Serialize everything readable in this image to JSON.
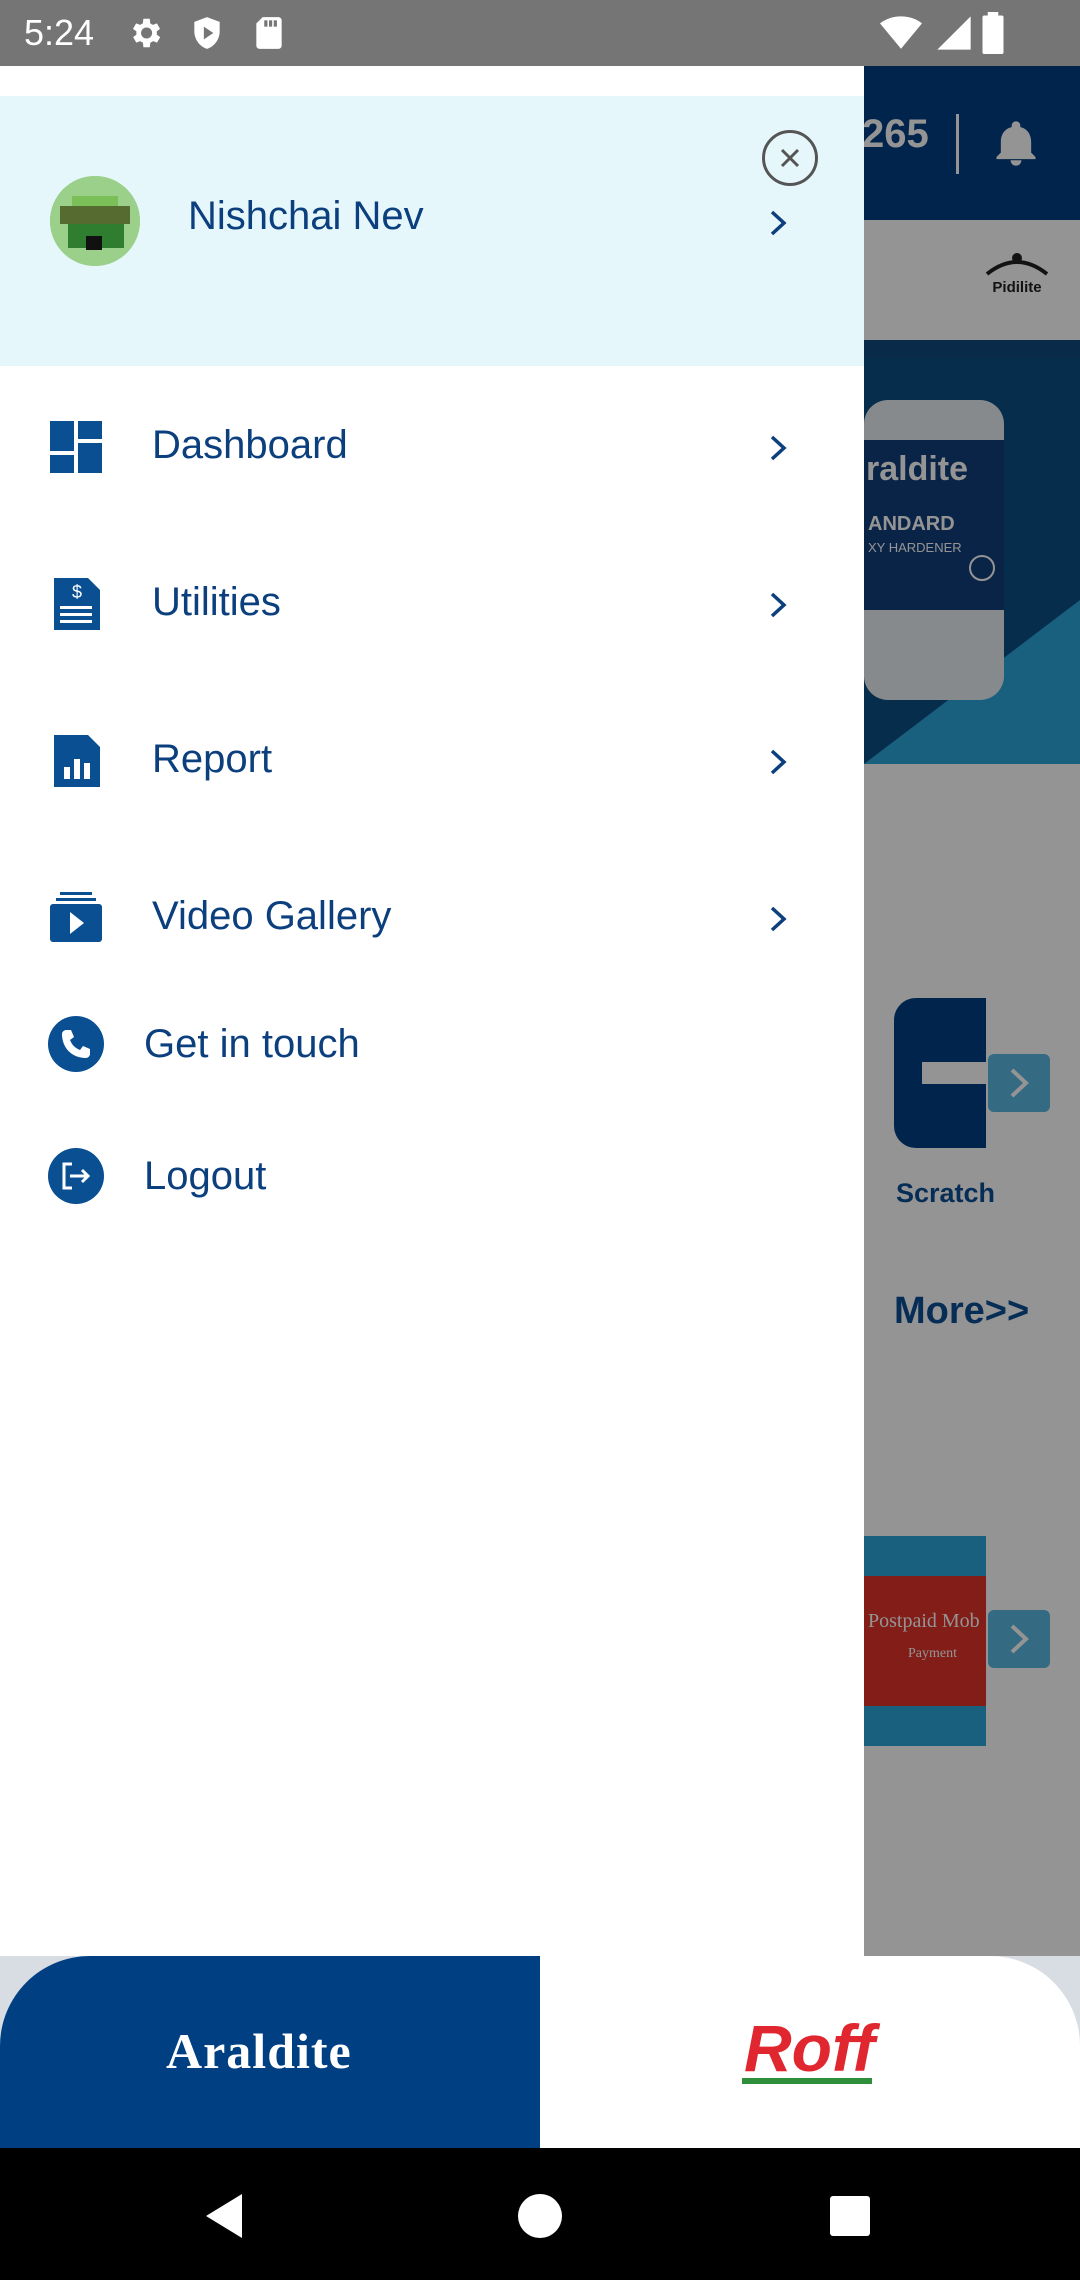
{
  "status_bar": {
    "time": "5:24",
    "left_icons": [
      "settings-icon",
      "shield-icon",
      "sd-card-icon"
    ],
    "right_icons": [
      "wifi-icon",
      "signal-icon",
      "battery-icon"
    ]
  },
  "background_app": {
    "points": "265",
    "more_link": "More>>",
    "scratch_label": "Scratch",
    "banner_text_1": "raldite",
    "banner_text_2": "ANDARD",
    "banner_text_3": "XY HARDENER",
    "pidilite_label": "Pidilite",
    "promo_title": "Postpaid Mob",
    "promo_subtitle": "Payment"
  },
  "drawer": {
    "profile": {
      "name": "Nishchai Nev"
    },
    "menu": [
      {
        "label": "Dashboard",
        "icon": "dashboard-icon",
        "has_chevron": true
      },
      {
        "label": "Utilities",
        "icon": "bill-icon",
        "has_chevron": true
      },
      {
        "label": "Report",
        "icon": "report-icon",
        "has_chevron": true
      },
      {
        "label": "Video Gallery",
        "icon": "video-gallery-icon",
        "has_chevron": true
      },
      {
        "label": "Get in touch",
        "icon": "phone-icon",
        "has_chevron": false
      },
      {
        "label": "Logout",
        "icon": "logout-icon",
        "has_chevron": false
      }
    ]
  },
  "brands": {
    "left": "Araldite",
    "right": "Roff"
  },
  "colors": {
    "primary": "#003f82",
    "menu_text": "#0b3f7d",
    "profile_bg": "#e6f7fb",
    "roff_red": "#e0262e"
  }
}
